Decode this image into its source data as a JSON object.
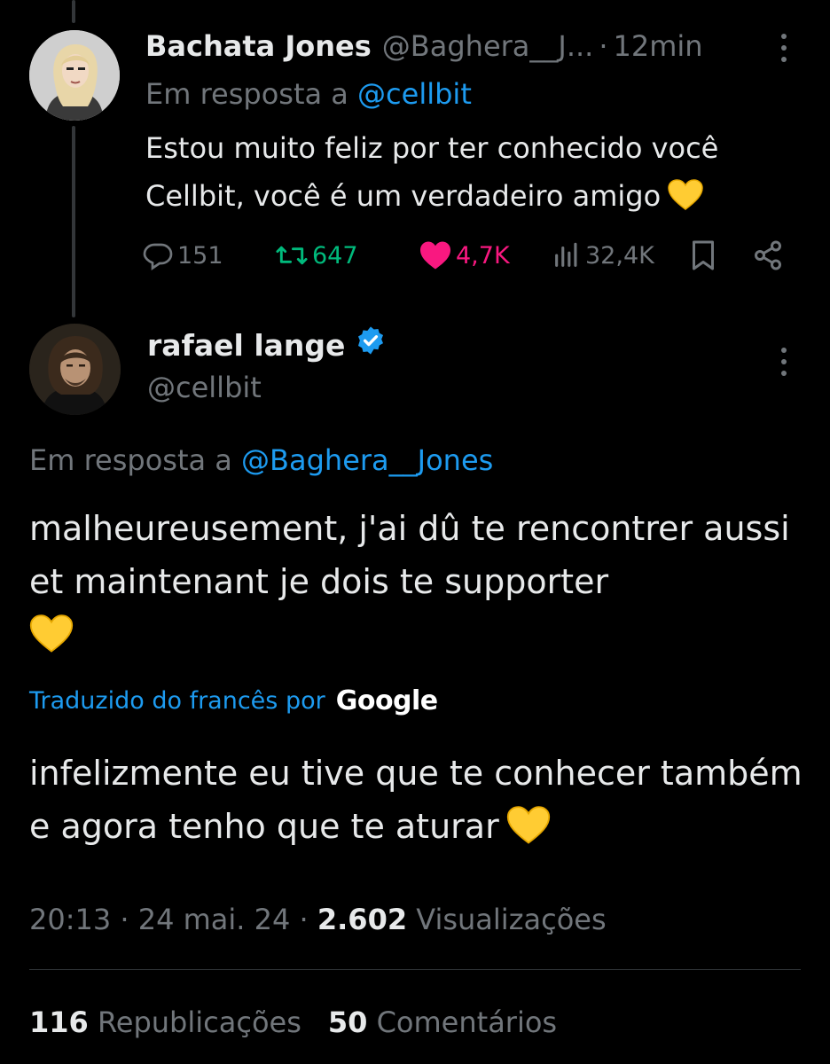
{
  "reply_tweet": {
    "author_name": "Bachata Jones",
    "author_handle": "@Baghera__J...",
    "separator": "·",
    "time": "12min",
    "replying_prefix": "Em resposta a",
    "replying_to": "@cellbit",
    "text": "Estou muito feliz por ter conhecido você Cellbit, você é um verdadeiro amigo",
    "replies": "151",
    "reposts": "647",
    "likes": "4,7K",
    "views": "32,4K",
    "icons": [
      "reply-icon",
      "retweet-icon",
      "heart-icon",
      "views-icon",
      "bookmark-icon",
      "share-icon",
      "more-icon",
      "yellow-heart-emoji"
    ],
    "colors": {
      "repost": "#00ba7c",
      "like": "#f91880",
      "muted": "#71767b"
    }
  },
  "main_tweet": {
    "author_name": "rafael lange",
    "author_handle": "@cellbit",
    "verified": true,
    "replying_prefix": "Em resposta a",
    "replying_to": "@Baghera__Jones",
    "text": "malheureusement, j'ai dû te rencontrer aussi et maintenant je dois te supporter",
    "translated_label": "Traduzido do francês por",
    "translator": "Google",
    "translation": "infelizmente eu tive que te conhecer também e agora tenho que te aturar",
    "time": "20:13",
    "dot": "·",
    "date": "24 mai. 24",
    "views_count": "2.602",
    "views_label": "Visualizações",
    "reposts_count": "116",
    "reposts_label": "Republicações",
    "comments_count": "50",
    "comments_label": "Comentários",
    "colors": {
      "link": "#1d9bf0",
      "verified": "#1d9bf0",
      "text": "#e7e9ea"
    }
  }
}
